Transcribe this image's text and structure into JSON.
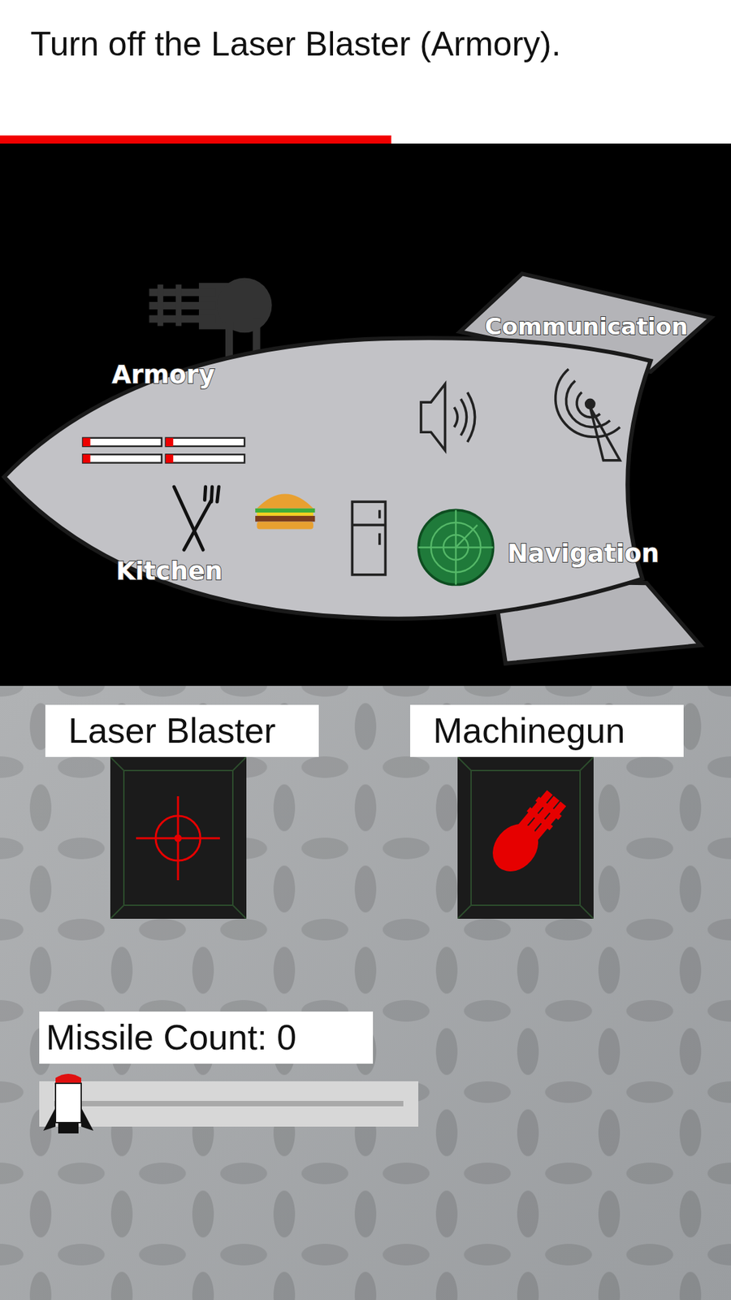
{
  "instruction": {
    "text": "Turn off the Laser Blaster (Armory).",
    "timer_level": 0.535
  },
  "ship": {
    "rooms": [
      {
        "label": "Armory"
      },
      {
        "label": "Communication"
      },
      {
        "label": "Kitchen"
      },
      {
        "label": "Navigation"
      }
    ]
  },
  "controls": {
    "toggles": [
      {
        "label": "Laser Blaster",
        "on": true,
        "kind": "laser"
      },
      {
        "label": "Machinegun",
        "on": true,
        "kind": "machinegun"
      }
    ],
    "slider": {
      "label": "Missile Count: 0",
      "level": 0
    }
  }
}
